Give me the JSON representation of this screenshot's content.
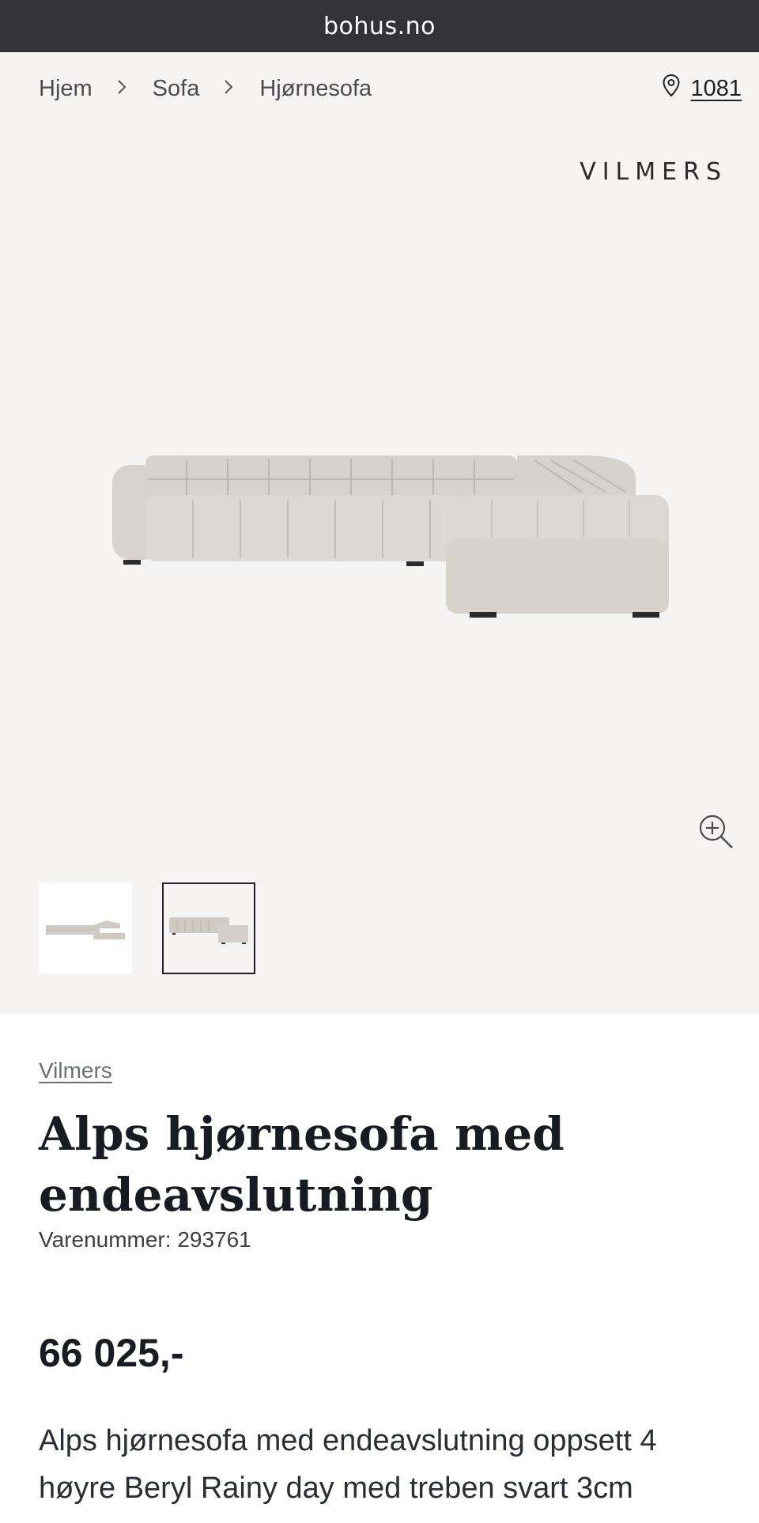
{
  "browser": {
    "url": "bohus.no"
  },
  "breadcrumb": {
    "items": [
      "Hjem",
      "Sofa",
      "Hjørnesofa"
    ],
    "separator": ">"
  },
  "store": {
    "icon": "location-pin-icon",
    "number": "1081"
  },
  "gallery": {
    "brand_logo": "VILMERS",
    "zoom_icon": "zoom-in-icon",
    "thumbnails": [
      {
        "name": "thumbnail-1",
        "selected": false
      },
      {
        "name": "thumbnail-2",
        "selected": true
      }
    ]
  },
  "product": {
    "brand": "Vilmers",
    "title": "Alps hjørnesofa med endeavslutning",
    "sku": "Varenummer: 293761",
    "price": "66 025,-",
    "description": "Alps hjørnesofa med endeavslutning oppsett 4 høyre Beryl Rainy day med treben svart 3cm"
  },
  "colors": {
    "status_bar": "#333337",
    "gallery_bg": "#f5f4f2",
    "text_dark": "#181c22"
  }
}
